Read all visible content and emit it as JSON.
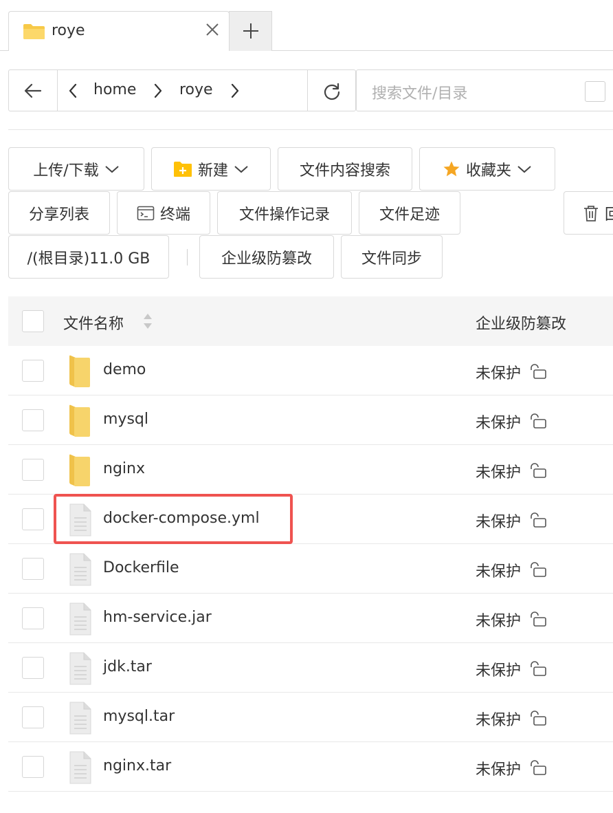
{
  "tabs": [
    {
      "title": "roye",
      "icon": "folder-icon"
    }
  ],
  "new_tab_icon": "plus-icon",
  "path": {
    "back_icon": "arrow-left-icon",
    "scroll_left_icon": "chevron-left-icon",
    "crumbs": [
      "home",
      "roye"
    ],
    "refresh_icon": "refresh-icon"
  },
  "search": {
    "placeholder": "搜索文件/目录"
  },
  "toolbar": {
    "upload_download": "上传/下载",
    "new": "新建",
    "content_search": "文件内容搜索",
    "favorites": "收藏夹",
    "share_list": "分享列表",
    "terminal": "终端",
    "op_log": "文件操作记录",
    "footprint": "文件足迹",
    "recycle": "回收站",
    "disk": "/(根目录)11.0 GB",
    "tamper_proof": "企业级防篡改",
    "sync": "文件同步"
  },
  "table": {
    "col_name": "文件名称",
    "col_protect": "企业级防篡改",
    "rows": [
      {
        "name": "demo",
        "type": "folder",
        "status": "未保护"
      },
      {
        "name": "mysql",
        "type": "folder",
        "status": "未保护"
      },
      {
        "name": "nginx",
        "type": "folder",
        "status": "未保护"
      },
      {
        "name": "docker-compose.yml",
        "type": "file",
        "status": "未保护",
        "highlighted": true
      },
      {
        "name": "Dockerfile",
        "type": "file",
        "status": "未保护"
      },
      {
        "name": "hm-service.jar",
        "type": "file",
        "status": "未保护"
      },
      {
        "name": "jdk.tar",
        "type": "file",
        "status": "未保护"
      },
      {
        "name": "mysql.tar",
        "type": "file",
        "status": "未保护"
      },
      {
        "name": "nginx.tar",
        "type": "file",
        "status": "未保护"
      }
    ]
  },
  "colors": {
    "folder": "#F7D46B",
    "folder_dark": "#F0C24A",
    "highlight": "#EF5350",
    "star": "#F5A623",
    "new_icon": "#FFC107"
  }
}
